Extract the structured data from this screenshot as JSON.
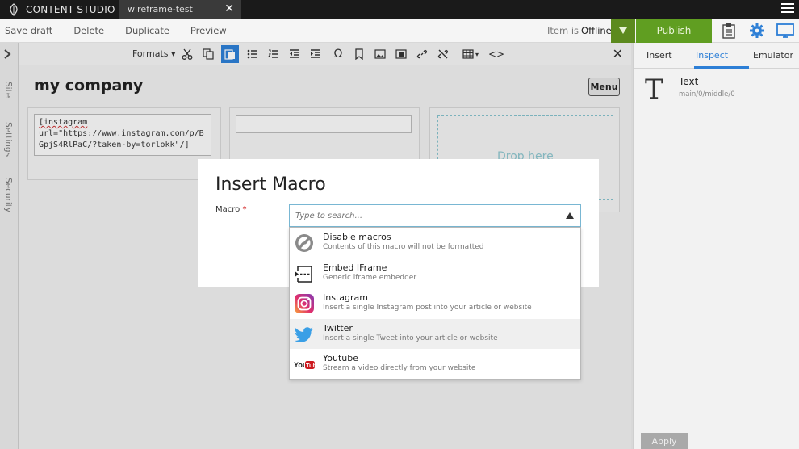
{
  "app": {
    "brand": "CONTENT STUDIO",
    "doc_tab": "wireframe-test",
    "close_glyph": "✕"
  },
  "toolbar": {
    "actions": [
      "Save draft",
      "Delete",
      "Duplicate",
      "Preview"
    ],
    "status_label": "Item is",
    "status_value": "Offline",
    "publish_label": "Publish"
  },
  "left_tabs": [
    "Site",
    "Settings",
    "Security"
  ],
  "editor": {
    "formats_label": "Formats",
    "close_glyph": "✕",
    "page_title": "my company",
    "menu_label": "Menu",
    "text_lines": [
      "[instagram",
      "url=\"https://www.instagram.com/p/B",
      "GpjS4RlPaC/?taken-by=torlokk\"/]"
    ],
    "drop_text": "Drop here"
  },
  "modal": {
    "title": "Insert Macro",
    "field_label": "Macro",
    "required_mark": "*",
    "search_placeholder": "Type to search...",
    "items": [
      {
        "title": "Disable macros",
        "desc": "Contents of this macro will not be formatted",
        "icon": "disable-macros-icon"
      },
      {
        "title": "Embed IFrame",
        "desc": "Generic iframe embedder",
        "icon": "iframe-icon"
      },
      {
        "title": "Instagram",
        "desc": "Insert a single Instagram post into your article or website",
        "icon": "instagram-icon"
      },
      {
        "title": "Twitter",
        "desc": "Insert a single Tweet into your article or website",
        "icon": "twitter-icon"
      },
      {
        "title": "Youtube",
        "desc": "Stream a video directly from your website",
        "icon": "youtube-icon"
      }
    ],
    "highlighted_index": 3
  },
  "right_panel": {
    "tabs": [
      "Insert",
      "Inspect",
      "Emulator"
    ],
    "active_tab": "Inspect",
    "component_glyph": "T",
    "component_name": "Text",
    "component_path": "main/0/middle/0",
    "apply_label": "Apply"
  },
  "colors": {
    "topbar": "#1a1a1a",
    "publish_green": "#609e21",
    "accent_blue": "#2d7fd6",
    "instagram_purple": "#8a3ab9",
    "twitter_blue": "#1da1f2",
    "youtube_red": "#cc181e"
  }
}
